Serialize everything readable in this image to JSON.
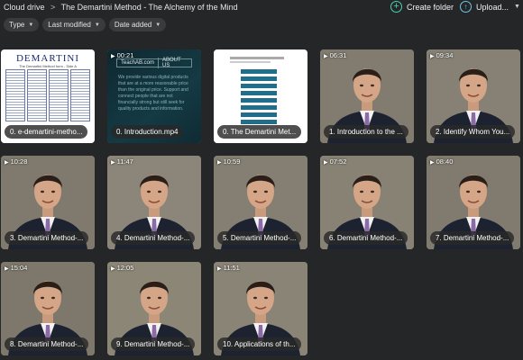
{
  "breadcrumb": {
    "root": "Cloud drive",
    "separator": ">",
    "current": "The Demartini Method - The Alchemy of the Mind"
  },
  "actions": {
    "create_folder": "Create folder",
    "upload": "Upload..."
  },
  "filters": [
    {
      "label": "Type"
    },
    {
      "label": "Last modified"
    },
    {
      "label": "Date added"
    }
  ],
  "tiles": [
    {
      "label": "0. e-demartini-metho...",
      "duration": "",
      "kind": "doc"
    },
    {
      "label": "0. Introduction.mp4",
      "duration": "00:21",
      "kind": "web"
    },
    {
      "label": "0. The Demartini Met...",
      "duration": "",
      "kind": "shot"
    },
    {
      "label": "1. Introduction to the ...",
      "duration": "06:31",
      "kind": "video"
    },
    {
      "label": "2. Identify Whom You...",
      "duration": "09:34",
      "kind": "video"
    },
    {
      "label": "3. Demartini Method-...",
      "duration": "10:28",
      "kind": "video"
    },
    {
      "label": "4. Demartini Method-...",
      "duration": "11:47",
      "kind": "video"
    },
    {
      "label": "5. Demartini Method-...",
      "duration": "10:59",
      "kind": "video"
    },
    {
      "label": "6. Demartini Method-...",
      "duration": "07:52",
      "kind": "video"
    },
    {
      "label": "7. Demartini Method-...",
      "duration": "08:40",
      "kind": "video"
    },
    {
      "label": "8. Demartini Method-...",
      "duration": "15:04",
      "kind": "video"
    },
    {
      "label": "9. Demartini Method-...",
      "duration": "12:05",
      "kind": "video"
    },
    {
      "label": "10. Applications of th...",
      "duration": "11:51",
      "kind": "video"
    }
  ],
  "doc_preview": {
    "title": "DEMARTINI",
    "subtitle": "The Demartini Method form - Side A"
  },
  "web_preview": {
    "site": "TeachAB.com",
    "menu": "ABOUT US",
    "text": "We provide various digital products that are at a more reasonable price than the original price. Support and connect people that are not financially strong but still seek for quality products and information."
  },
  "colors": {
    "background": "#252627",
    "chip": "#3a3b3d",
    "accent_create": "#4bd1b2",
    "accent_upload": "#6fc6ea"
  }
}
